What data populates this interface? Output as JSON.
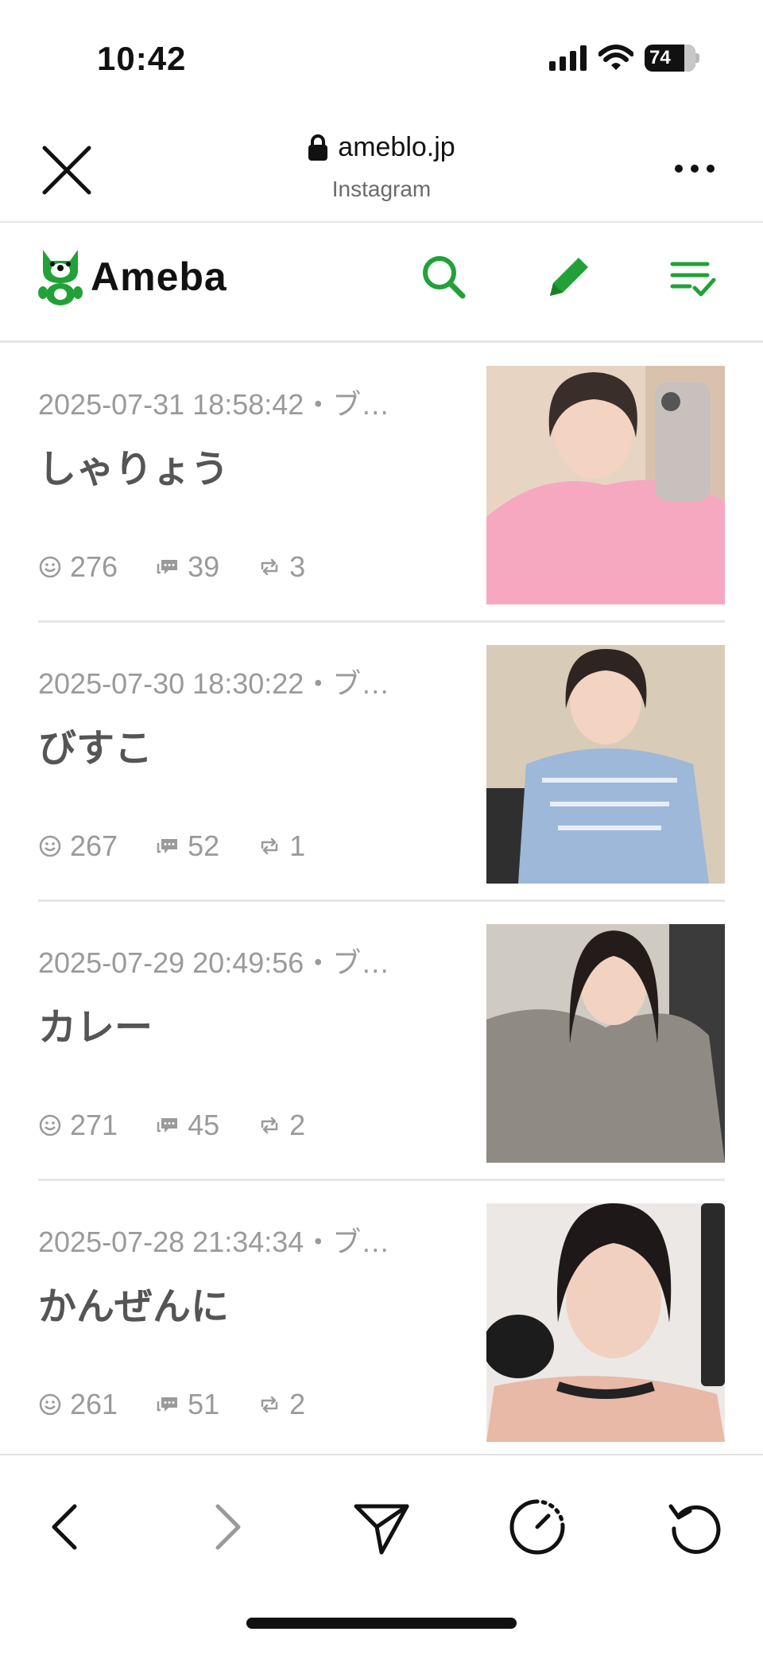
{
  "status_bar": {
    "time": "10:42",
    "battery": "74"
  },
  "browser": {
    "domain": "ameblo.jp",
    "subtitle": "Instagram"
  },
  "app": {
    "logo_text": "Ameba",
    "brand_color": "#22a139"
  },
  "posts": [
    {
      "datetime": "2025-07-31 18:58:42・ブ…",
      "title": "しゃりょう",
      "likes": "276",
      "comments": "39",
      "reblogs": "3"
    },
    {
      "datetime": "2025-07-30 18:30:22・ブ…",
      "title": "びすこ",
      "likes": "267",
      "comments": "52",
      "reblogs": "1"
    },
    {
      "datetime": "2025-07-29 20:49:56・ブ…",
      "title": "カレー",
      "likes": "271",
      "comments": "45",
      "reblogs": "2"
    },
    {
      "datetime": "2025-07-28 21:34:34・ブ…",
      "title": "かんぜんに",
      "likes": "261",
      "comments": "51",
      "reblogs": "2"
    }
  ]
}
